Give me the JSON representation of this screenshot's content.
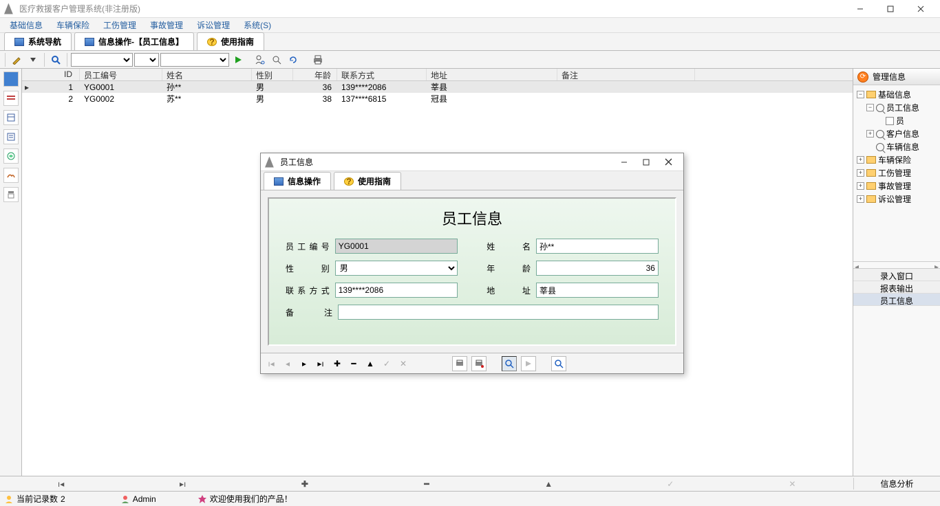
{
  "window": {
    "title": "医疗救援客户管理系统(非注册版)"
  },
  "menu": [
    "基础信息",
    "车辆保险",
    "工伤管理",
    "事故管理",
    "诉讼管理",
    "系统(S)"
  ],
  "main_tabs": [
    {
      "label": "系统导航"
    },
    {
      "label": "信息操作-【员工信息】"
    },
    {
      "label": "使用指南"
    }
  ],
  "grid": {
    "columns": [
      "ID",
      "员工编号",
      "姓名",
      "性别",
      "年龄",
      "联系方式",
      "地址",
      "备注"
    ],
    "rows": [
      {
        "id": "1",
        "empid": "YG0001",
        "name": "孙**",
        "sex": "男",
        "age": "36",
        "tel": "139****2086",
        "addr": "莘县",
        "note": ""
      },
      {
        "id": "2",
        "empid": "YG0002",
        "name": "苏**",
        "sex": "男",
        "age": "38",
        "tel": "137****6815",
        "addr": "冠县",
        "note": ""
      }
    ]
  },
  "right_panel": {
    "title": "管理信息",
    "tree": [
      {
        "indent": 0,
        "exp": "−",
        "kind": "folder",
        "label": "基础信息"
      },
      {
        "indent": 1,
        "exp": "−",
        "kind": "mag",
        "label": "员工信息"
      },
      {
        "indent": 2,
        "exp": "",
        "kind": "doc",
        "label": "员"
      },
      {
        "indent": 1,
        "exp": "+",
        "kind": "mag",
        "label": "客户信息"
      },
      {
        "indent": 1,
        "exp": "",
        "kind": "mag",
        "label": "车辆信息"
      },
      {
        "indent": 0,
        "exp": "+",
        "kind": "folder",
        "label": "车辆保险"
      },
      {
        "indent": 0,
        "exp": "+",
        "kind": "folder",
        "label": "工伤管理"
      },
      {
        "indent": 0,
        "exp": "+",
        "kind": "folder",
        "label": "事故管理"
      },
      {
        "indent": 0,
        "exp": "+",
        "kind": "folder",
        "label": "诉讼管理"
      }
    ],
    "tabs": [
      "录入窗口",
      "报表输出",
      "员工信息"
    ],
    "active_tab": 2,
    "analysis": "信息分析"
  },
  "dialog": {
    "title": "员工信息",
    "tabs": [
      "信息操作",
      "使用指南"
    ],
    "heading": "员工信息",
    "fields": {
      "empid_label": "员工编号",
      "empid": "YG0001",
      "name_label": "姓　　名",
      "name": "孙**",
      "sex_label": "性　　别",
      "sex": "男",
      "age_label": "年　　龄",
      "age": "36",
      "tel_label": "联系方式",
      "tel": "139****2086",
      "addr_label": "地　　址",
      "addr": "莘县",
      "note_label": "备　　注",
      "note": ""
    }
  },
  "status": {
    "records_label": "当前记录数",
    "records": "2",
    "user": "Admin",
    "welcome": "欢迎使用我们的产品！"
  },
  "nav_glyphs": {
    "first": "⊏",
    "last": "⊐",
    "plus": "✚",
    "minus": "━",
    "up": "▲",
    "edit": "✎",
    "cancel": "✕"
  }
}
